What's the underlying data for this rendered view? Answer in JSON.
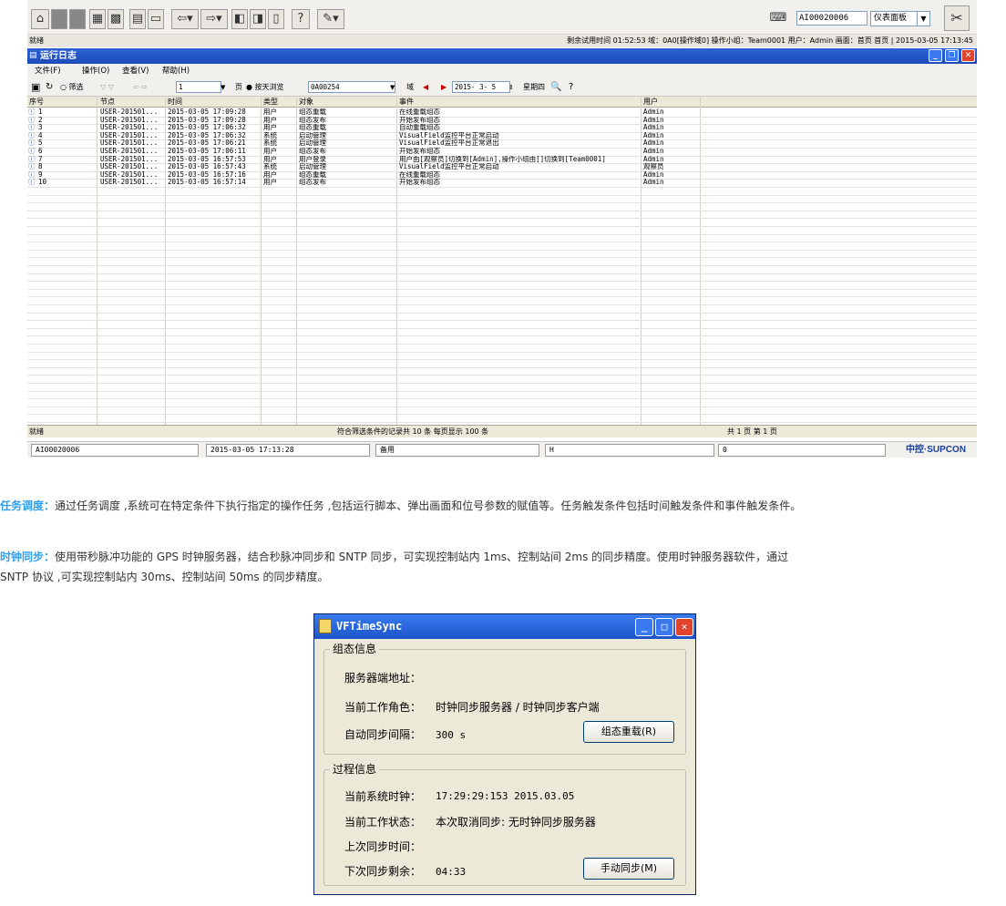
{
  "toolbar": {
    "tag_value": "AI00020006",
    "panel_select": "仪表面板"
  },
  "statusline": {
    "left": "就绪",
    "right": "剩余试用时间 01:52:53 域：0A0[操作域0] 操作小组：Team0001 用户：Admin 画面：首页 首页 | 2015-03-05 17:13:45"
  },
  "window": {
    "title": "运行日志"
  },
  "menu": [
    "文件(F)",
    "操作(O)",
    "查看(V)",
    "帮助(H)"
  ],
  "filter": {
    "radio_filter": "筛选",
    "page_value": "1",
    "page_unit": "页",
    "radio_day": "按天浏览",
    "domain_value": "0A00254",
    "domain_label": "域",
    "date_value": "2015- 3- 5",
    "weekday": "星期四"
  },
  "log": {
    "columns": [
      "序号",
      "节点",
      "时间",
      "类型",
      "对象",
      "事件",
      "用户"
    ],
    "rows": [
      [
        "1",
        "USER-201501...",
        "2015-03-05 17:09:28",
        "用户",
        "组态重载",
        "在线重载组态",
        "Admin"
      ],
      [
        "2",
        "USER-201501...",
        "2015-03-05 17:09:28",
        "用户",
        "组态发布",
        "开始发布组态",
        "Admin"
      ],
      [
        "3",
        "USER-201501...",
        "2015-03-05 17:06:32",
        "用户",
        "组态重载",
        "自动重载组态",
        "Admin"
      ],
      [
        "4",
        "USER-201501...",
        "2015-03-05 17:06:32",
        "系统",
        "启动管理",
        "VisualField监控平台正常启动",
        "Admin"
      ],
      [
        "5",
        "USER-201501...",
        "2015-03-05 17:06:21",
        "系统",
        "启动管理",
        "VisualField监控平台正常退出",
        "Admin"
      ],
      [
        "6",
        "USER-201501...",
        "2015-03-05 17:06:11",
        "用户",
        "组态发布",
        "开始发布组态",
        "Admin"
      ],
      [
        "7",
        "USER-201501...",
        "2015-03-05 16:57:53",
        "用户",
        "用户登录",
        "用户由[观察员]切换到[Admin],操作小组由[]切换到[Team0001]",
        "Admin"
      ],
      [
        "8",
        "USER-201501...",
        "2015-03-05 16:57:43",
        "系统",
        "启动管理",
        "VisualField监控平台正常启动",
        "观察员"
      ],
      [
        "9",
        "USER-201501...",
        "2015-03-05 16:57:16",
        "用户",
        "组态重载",
        "在线重载组态",
        "Admin"
      ],
      [
        "10",
        "USER-201501...",
        "2015-03-05 16:57:14",
        "用户",
        "组态发布",
        "开始发布组态",
        "Admin"
      ]
    ],
    "footer_left": "就绪",
    "footer_mid": "符合筛选条件的记录共 10 条   每页显示 100 条",
    "footer_right": "共 1 页  第 1 页"
  },
  "app_status": {
    "tag": "AI00020006",
    "datetime": "2015-03-05 17:13:28",
    "note": "备用",
    "flag": "H",
    "count": "0",
    "logo": "中控·SUPCON"
  },
  "para1": {
    "keyword": "任务调度：",
    "text": "通过任务调度 ,系统可在特定条件下执行指定的操作任务 ,包括运行脚本、弹出画面和位号参数的赋值等。任务触发条件包括时间触发条件和事件触发条件。"
  },
  "para2": {
    "keyword": "时钟同步：",
    "text1": "使用带秒脉冲功能的 GPS 时钟服务器，结合秒脉冲同步和 SNTP 同步，可实现控制站内 1ms、控制站间 2ms 的同步精度。使用时钟服务器软件，通过",
    "text2": "SNTP 协议 ,可实现控制站内 30ms、控制站间 50ms 的同步精度。"
  },
  "dialog": {
    "title": "VFTimeSync",
    "group1": {
      "title": "组态信息",
      "server_label": "服务器端地址：",
      "role_label": "当前工作角色：",
      "role_value": "时钟同步服务器 / 时钟同步客户端",
      "interval_label": "自动同步间隔：",
      "interval_value": "300 s",
      "reload_button": "组态重载(R)"
    },
    "group2": {
      "title": "过程信息",
      "clock_label": "当前系统时钟：",
      "clock_value": "17:29:29:153 2015.03.05",
      "state_label": "当前工作状态：",
      "state_value": "本次取消同步: 无时钟同步服务器",
      "last_label": "上次同步时间：",
      "next_label": "下次同步剩余：",
      "next_value": "04:33",
      "sync_button": "手动同步(M)"
    }
  },
  "colors": {
    "accent": "#2e9ff0",
    "titlebar": "#1d4ab8"
  }
}
